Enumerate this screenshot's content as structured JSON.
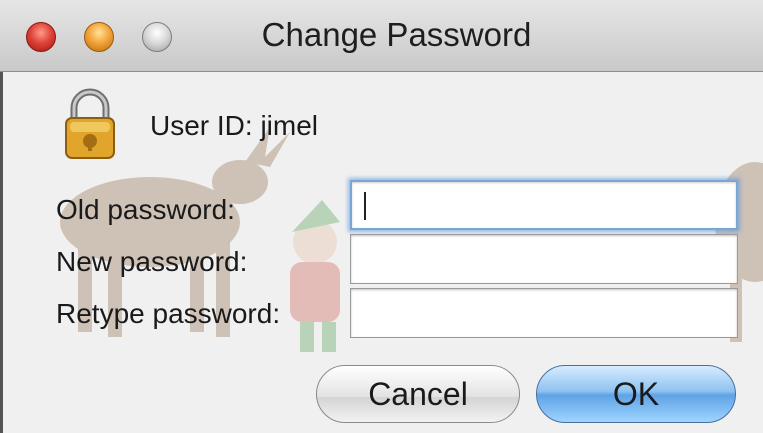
{
  "window": {
    "title": "Change Password",
    "controls": {
      "close": "close-button",
      "minimize": "minimize-button",
      "zoom": "zoom-button"
    }
  },
  "header": {
    "user_id_text": "User ID: jimel",
    "icon": "lock-icon"
  },
  "form": {
    "old_password_label": "Old password:",
    "new_password_label": "New password:",
    "retype_password_label": "Retype password:",
    "old_password_value": "",
    "new_password_value": "",
    "retype_password_value": ""
  },
  "buttons": {
    "cancel_label": "Cancel",
    "ok_label": "OK"
  },
  "colors": {
    "close": "#e0443a",
    "minimize": "#f3a53a",
    "zoom": "#dadada",
    "focus": "#7aa6d6",
    "default_button": "#5fa3e6"
  }
}
